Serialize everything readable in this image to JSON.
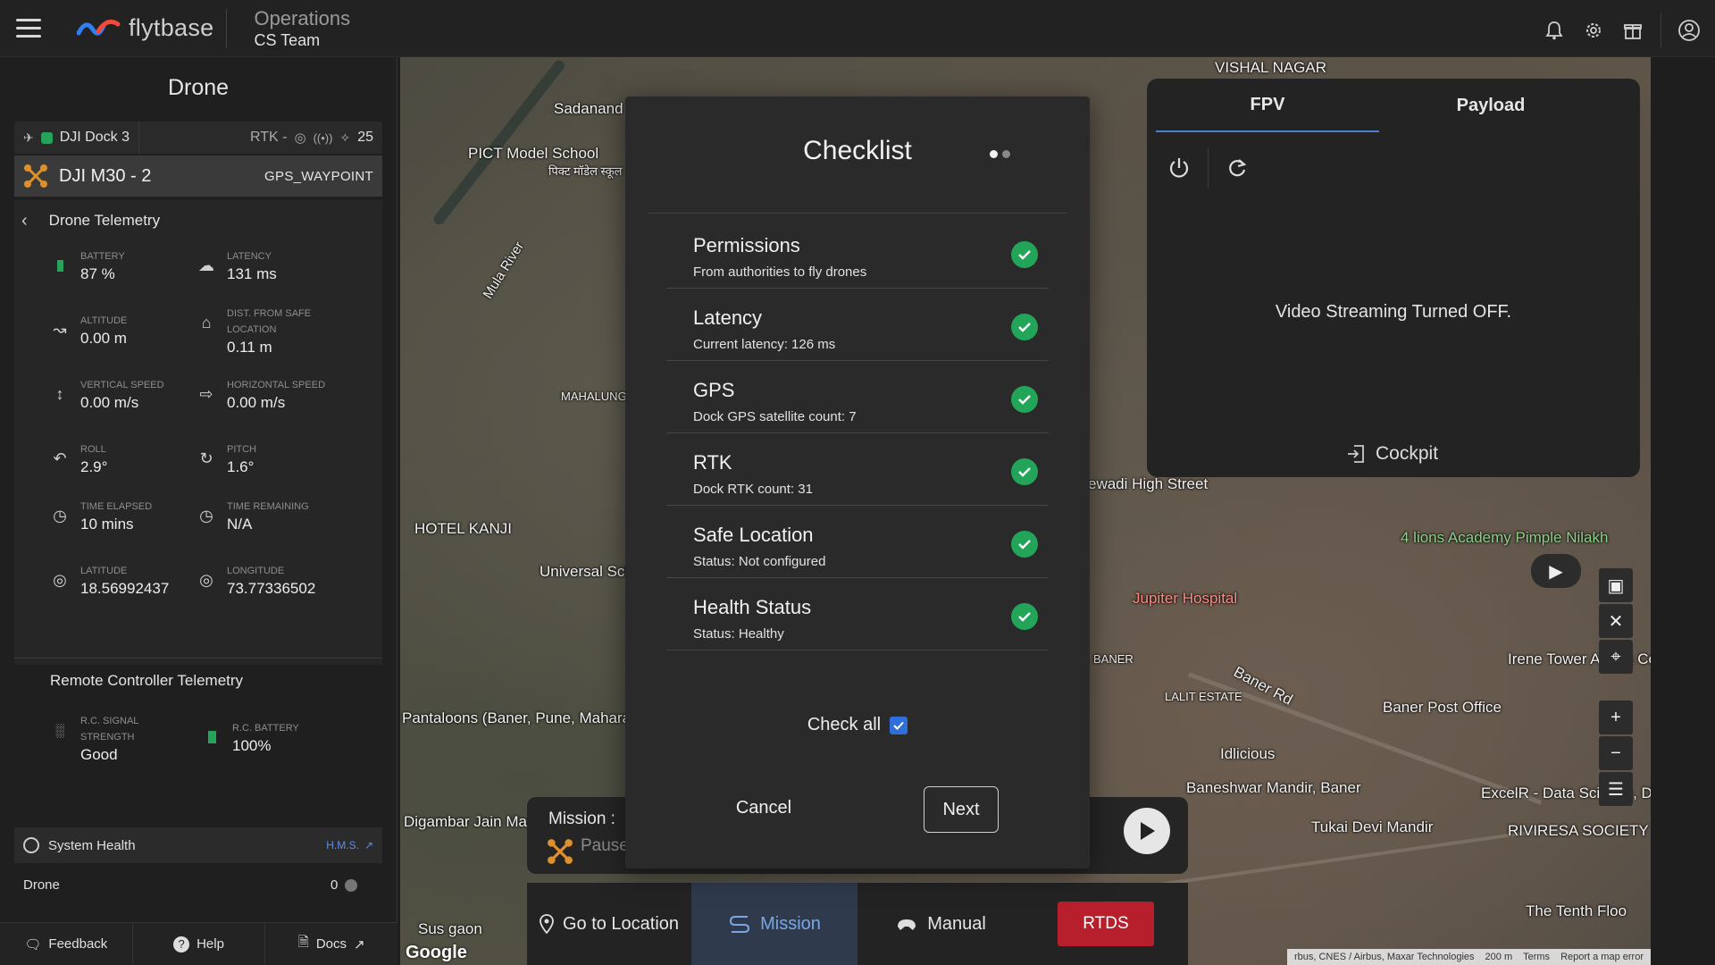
{
  "topbar": {
    "brand": "flytbase",
    "section": "Operations",
    "team": "CS Team",
    "icons": [
      "bell-icon",
      "gear-icon",
      "gift-icon",
      "user-icon"
    ]
  },
  "left": {
    "title": "Drone",
    "dock": {
      "name": "DJI Dock 3",
      "rtk": "RTK -",
      "satellites": "25"
    },
    "drone": {
      "name": "DJI M30 - 2",
      "mode": "GPS_WAYPOINT"
    },
    "telemetry": {
      "header": "Drone Telemetry",
      "items": [
        {
          "label": "BATTERY",
          "value": "87 %"
        },
        {
          "label": "LATENCY",
          "value": "131 ms"
        },
        {
          "label": "ALTITUDE",
          "value": "0.00 m"
        },
        {
          "label": "DIST. FROM SAFE LOCATION",
          "value": "0.11 m"
        },
        {
          "label": "VERTICAL SPEED",
          "value": "0.00 m/s"
        },
        {
          "label": "HORIZONTAL SPEED",
          "value": "0.00 m/s"
        },
        {
          "label": "ROLL",
          "value": "2.9°"
        },
        {
          "label": "PITCH",
          "value": "1.6°"
        },
        {
          "label": "TIME ELAPSED",
          "value": "10 mins"
        },
        {
          "label": "TIME REMAINING",
          "value": "N/A"
        },
        {
          "label": "LATITUDE",
          "value": "18.56992437"
        },
        {
          "label": "LONGITUDE",
          "value": "73.77336502"
        }
      ]
    },
    "rc": {
      "header": "Remote Controller Telemetry",
      "signal_label": "R.C. SIGNAL STRENGTH",
      "signal_value": "Good",
      "battery_label": "R.C. BATTERY",
      "battery_value": "100%"
    },
    "system_health": {
      "title": "System Health",
      "hms": "H.M.S.",
      "drone_label": "Drone",
      "drone_value": "0"
    },
    "bottom": {
      "feedback": "Feedback",
      "help": "Help",
      "docs": "Docs"
    }
  },
  "map": {
    "labels": {
      "vishal_nagar": "VISHAL NAGAR",
      "sadanand": "Sadanand",
      "pict": "PICT Model School",
      "pict_hi": "पिक्ट मॉडेल स्कूल",
      "mula_river": "Mula River",
      "mahalunge": "MAHALUNGE",
      "hotel_kanji": "HOTEL KANJI",
      "universal_school": "Universal School (Inte",
      "pantaloons": "Pantaloons (Baner, Pune, Maharashtra)",
      "digambar": "Digambar Jain Mandir",
      "sus_gaon": "Sus gaon",
      "jupiter": "Jupiter Hospital",
      "four_lions": "4 lions Academy Pimple Nilakh",
      "baner_rd": "Baner Rd",
      "baner_post": "Baner Post Office",
      "lalit_estate": "LALIT ESTATE",
      "idlicious": "Idlicious",
      "baneshwar": "Baneshwar Mandir, Baner",
      "tukai": "Tukai Devi Mandir",
      "excelr": "ExcelR - Data Science, Data Analytics Course...",
      "riviresa": "RIVIRESA SOCIETY",
      "tenth_floor": "The Tenth Floo",
      "irene": "Irene Tower Aloma County",
      "wadi": "ewadi High Street",
      "baner": "BANER",
      "google": "Google"
    },
    "footer": [
      "rbus, CNES / Airbus, Maxar Technologies",
      "200 m",
      "Terms",
      "Report a map error"
    ],
    "controls": [
      "cube-icon",
      "crosshair-icon",
      "target-icon",
      "plus-icon",
      "minus-icon",
      "layers-icon"
    ]
  },
  "fpv": {
    "tabs": [
      "FPV",
      "Payload"
    ],
    "message": "Video Streaming Turned OFF.",
    "cockpit": "Cockpit"
  },
  "mission": {
    "title": "Mission :",
    "status": "Pause"
  },
  "modes": {
    "goto": "Go to Location",
    "mission": "Mission",
    "manual": "Manual",
    "rtds": "RTDS"
  },
  "checklist": {
    "title": "Checklist",
    "items": [
      {
        "name": "Permissions",
        "desc": "From authorities to fly drones"
      },
      {
        "name": "Latency",
        "desc": "Current latency: 126 ms"
      },
      {
        "name": "GPS",
        "desc": "Dock GPS satellite count: 7"
      },
      {
        "name": "RTK",
        "desc": "Dock RTK count: 31"
      },
      {
        "name": "Safe Location",
        "desc": "Status: Not configured"
      },
      {
        "name": "Health Status",
        "desc": "Status: Healthy"
      }
    ],
    "check_all": "Check all",
    "cancel": "Cancel",
    "next": "Next"
  },
  "colors": {
    "accent": "#4d7ecb",
    "ok": "#22a559",
    "danger": "#b81f2c"
  }
}
